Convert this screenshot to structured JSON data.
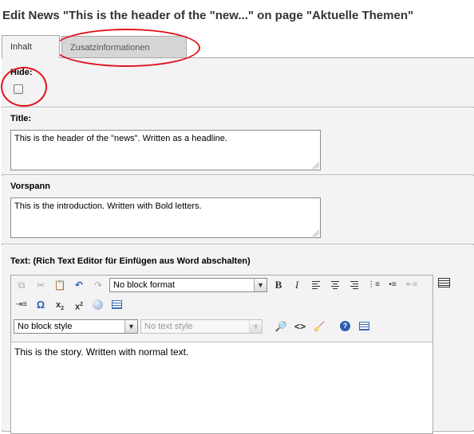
{
  "page_title": "Edit News \"This is the header of the \"new...\" on page \"Aktuelle Themen\"",
  "tabs": [
    {
      "label": "Inhalt",
      "active": true
    },
    {
      "label": "Zusatzinformationen",
      "active": false
    }
  ],
  "fields": {
    "hide": {
      "label": "Hide:",
      "checked": false
    },
    "title": {
      "label": "Title:",
      "value": "This is the header of the \"news\". Written as a headline."
    },
    "vorspann": {
      "label": "Vorspann",
      "value": "This is the introduction. Written with Bold letters."
    },
    "text": {
      "label": "Text: (Rich Text Editor für Einfügen aus Word abschalten)"
    }
  },
  "editor": {
    "block_format": {
      "selected": "No block format"
    },
    "block_style": {
      "selected": "No block style"
    },
    "text_style": {
      "placeholder": "No text style"
    },
    "content": "This is the story. Written with normal text.",
    "toolbar_icons": [
      "copy-icon",
      "cut-icon",
      "paste-icon",
      "undo-icon",
      "redo-icon",
      "bold-icon",
      "italic-icon",
      "align-left-icon",
      "align-center-icon",
      "align-right-icon",
      "ordered-list-icon",
      "unordered-list-icon",
      "outdent-icon",
      "indent-icon",
      "special-char-icon",
      "subscript-icon",
      "superscript-icon",
      "insert-image-icon",
      "insert-table-icon",
      "find-replace-icon",
      "html-source-icon",
      "clean-word-icon",
      "help-icon",
      "table-props-icon",
      "toggle-rte-icon"
    ]
  },
  "annotation_color": "#e0141b"
}
